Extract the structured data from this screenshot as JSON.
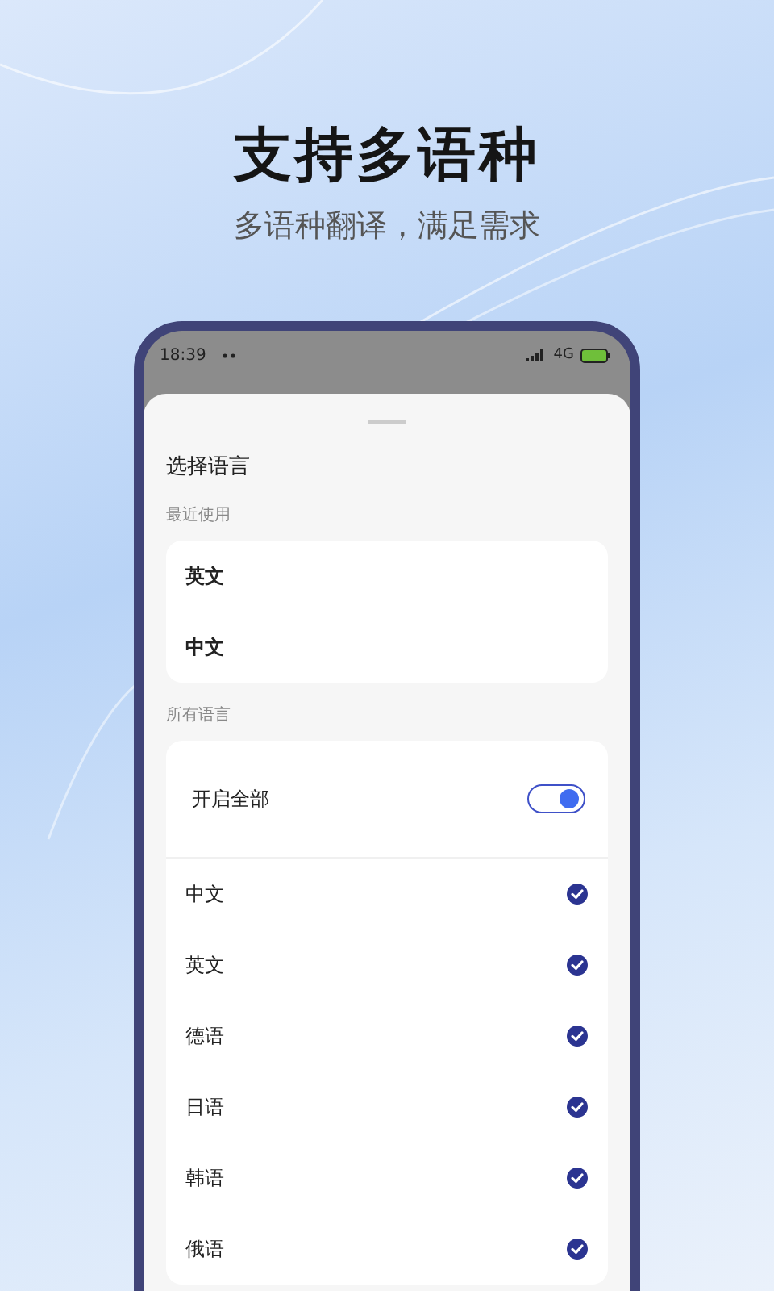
{
  "headline": "支持多语种",
  "subtitle": "多语种翻译，满足需求",
  "status_bar": {
    "time": "18:39",
    "network": "4G"
  },
  "sheet": {
    "title": "选择语言",
    "recent": {
      "label": "最近使用",
      "items": [
        {
          "label": "英文"
        },
        {
          "label": "中文"
        }
      ]
    },
    "all": {
      "label": "所有语言",
      "enable_all": {
        "label": "开启全部",
        "on": true
      },
      "items": [
        {
          "label": "中文",
          "checked": true
        },
        {
          "label": "英文",
          "checked": true
        },
        {
          "label": "德语",
          "checked": true
        },
        {
          "label": "日语",
          "checked": true
        },
        {
          "label": "韩语",
          "checked": true
        },
        {
          "label": "俄语",
          "checked": true
        }
      ]
    }
  }
}
